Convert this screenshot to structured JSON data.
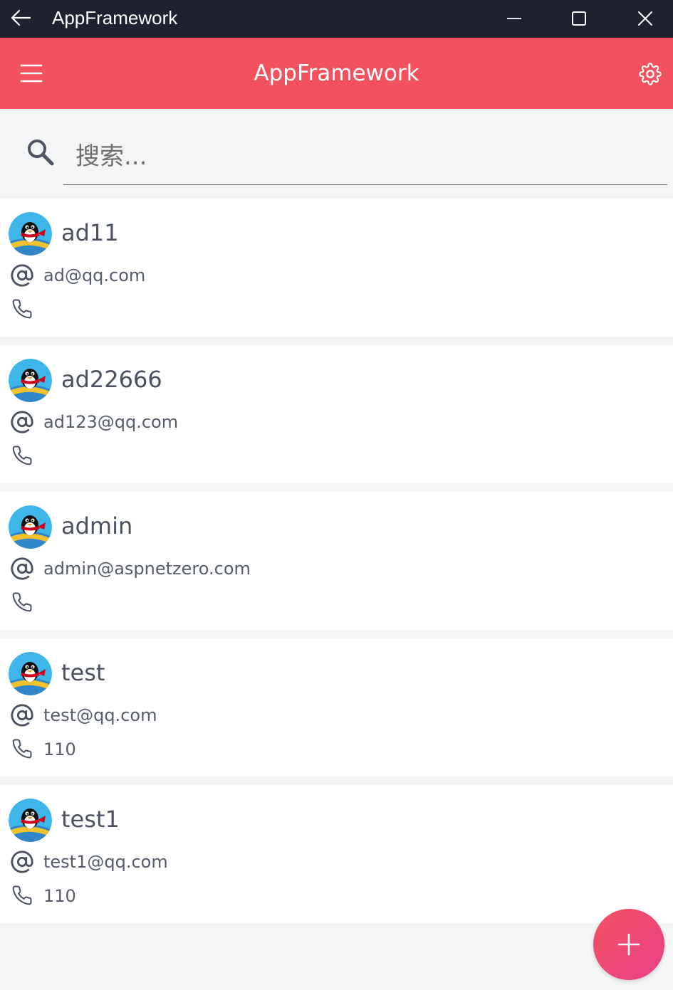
{
  "window": {
    "title": "AppFramework"
  },
  "appbar": {
    "title": "AppFramework"
  },
  "search": {
    "placeholder": "搜索..."
  },
  "users": [
    {
      "name": "ad11",
      "email": "ad@qq.com",
      "phone": ""
    },
    {
      "name": "ad22666",
      "email": "ad123@qq.com",
      "phone": ""
    },
    {
      "name": "admin",
      "email": "admin@aspnetzero.com",
      "phone": ""
    },
    {
      "name": "test",
      "email": "test@qq.com",
      "phone": "110"
    },
    {
      "name": "test1",
      "email": "test1@qq.com",
      "phone": "110"
    }
  ],
  "colors": {
    "titlebar": "#1e2230",
    "accent": "#f4515f",
    "fab_end": "#e8408a"
  },
  "icons": {
    "back": "arrow-left-icon",
    "minimize": "minimize-icon",
    "maximize": "maximize-icon",
    "close": "close-icon",
    "menu": "hamburger-menu-icon",
    "settings": "gear-icon",
    "search": "search-icon",
    "email": "at-sign-icon",
    "phone": "phone-icon",
    "add": "plus-icon",
    "avatar": "penguin-avatar-icon"
  }
}
